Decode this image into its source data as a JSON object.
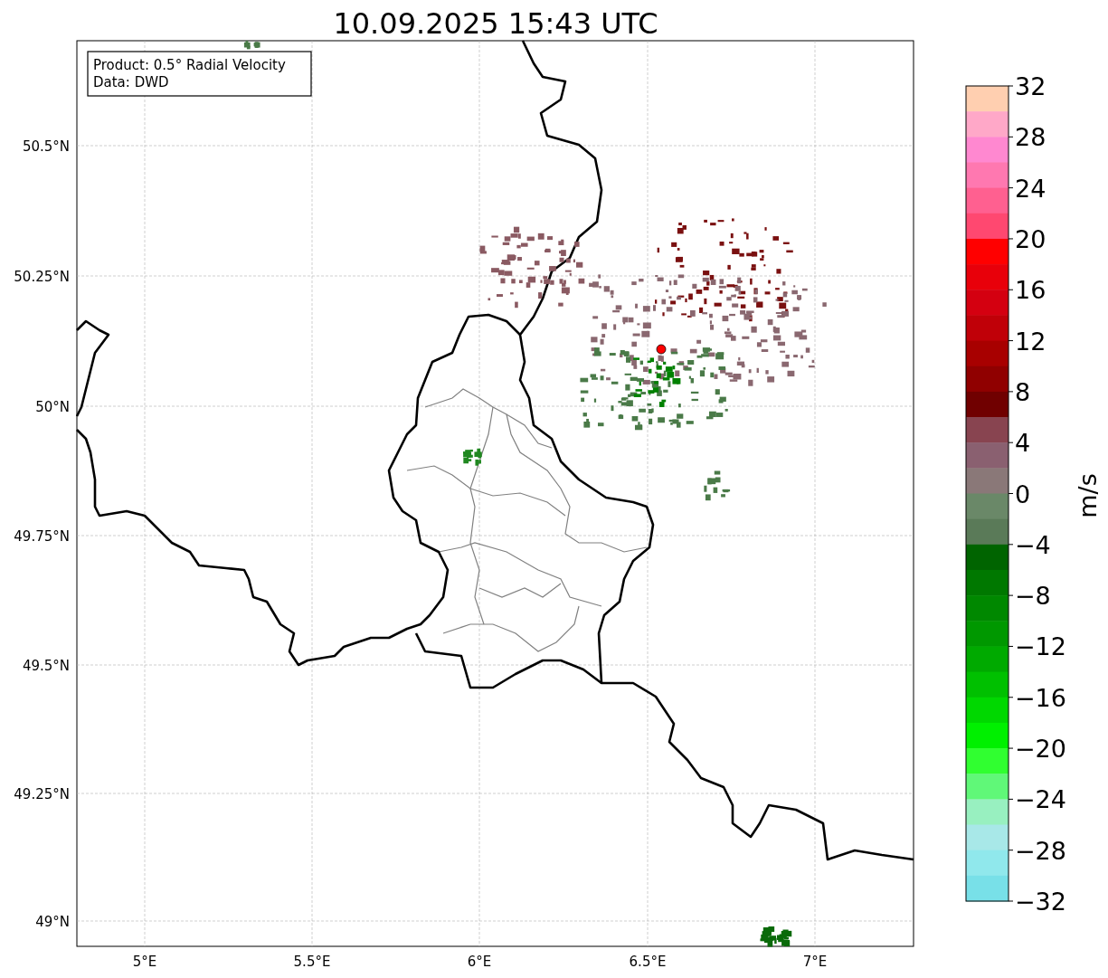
{
  "title": "10.09.2025 15:43 UTC",
  "map": {
    "info_box": [
      "Product: 0.5° Radial Velocity",
      "Data: DWD"
    ],
    "lat_ticks": [
      "50.5°N",
      "50.25°N",
      "50°N",
      "49.75°N",
      "49.5°N",
      "49.25°N",
      "49°N"
    ],
    "lon_ticks": [
      "5°E",
      "5.5°E",
      "6°E",
      "6.5°E",
      "7°E"
    ]
  },
  "colorbar": {
    "label": "m/s",
    "ticks": [
      "32",
      "28",
      "24",
      "20",
      "16",
      "12",
      "8",
      "4",
      "0",
      "−4",
      "−8",
      "−12",
      "−16",
      "−20",
      "−24",
      "−28",
      "−32"
    ],
    "segments": [
      {
        "color": "#ffcfb0"
      },
      {
        "color": "#ffa8c8"
      },
      {
        "color": "#ff88d0"
      },
      {
        "color": "#ff78b0"
      },
      {
        "color": "#ff6090"
      },
      {
        "color": "#ff4870"
      },
      {
        "color": "#ff0000"
      },
      {
        "color": "#e8000a"
      },
      {
        "color": "#d40010"
      },
      {
        "color": "#c00008"
      },
      {
        "color": "#a80000"
      },
      {
        "color": "#900000"
      },
      {
        "color": "#700000"
      },
      {
        "color": "#884450"
      },
      {
        "color": "#8a6070"
      },
      {
        "color": "#8a7878"
      },
      {
        "color": "#6a8868"
      },
      {
        "color": "#5a7a58"
      },
      {
        "color": "#006400"
      },
      {
        "color": "#007800"
      },
      {
        "color": "#008800"
      },
      {
        "color": "#009800"
      },
      {
        "color": "#00aa00"
      },
      {
        "color": "#00c000"
      },
      {
        "color": "#00d800"
      },
      {
        "color": "#00f000"
      },
      {
        "color": "#30ff30"
      },
      {
        "color": "#60f878"
      },
      {
        "color": "#98f0c0"
      },
      {
        "color": "#a8e8e8"
      },
      {
        "color": "#90e8ec"
      },
      {
        "color": "#78e0e8"
      }
    ]
  }
}
